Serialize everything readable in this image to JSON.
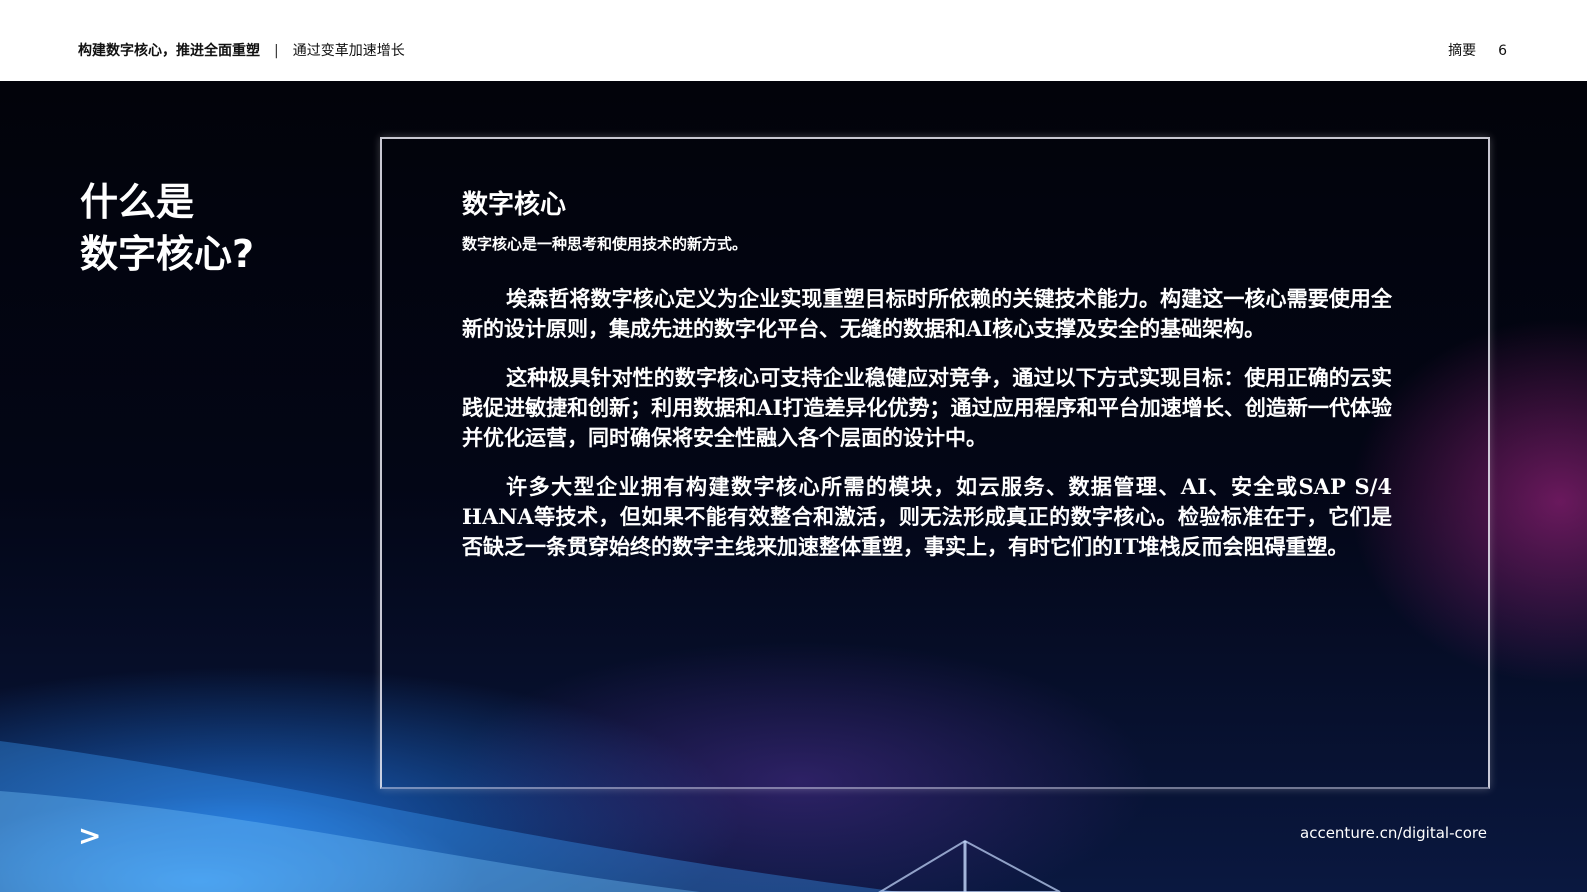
{
  "header": {
    "report_title": "构建数字核心，推进全面重塑",
    "separator": "|",
    "section": "通过变革加速增长",
    "chapter": "摘要",
    "page_number": "6"
  },
  "main": {
    "title_line1": "什么是",
    "title_line2": "数字核心?",
    "box": {
      "heading": "数字核心",
      "subheading": "数字核心是一种思考和使用技术的新方式。",
      "paragraphs": [
        "埃森哲将数字核心定义为企业实现重塑目标时所依赖的关键技术能力。构建这一核心需要使用全新的设计原则，集成先进的数字化平台、无缝的数据和AI核心支撑及安全的基础架构。",
        "这种极具针对性的数字核心可支持企业稳健应对竞争，通过以下方式实现目标：使用正确的云实践促进敏捷和创新；利用数据和AI打造差异化优势；通过应用程序和平台加速增长、创造新一代体验并优化运营，同时确保将安全性融入各个层面的设计中。",
        "许多大型企业拥有构建数字核心所需的模块，如云服务、数据管理、AI、安全或SAP S/4 HANA等技术，但如果不能有效整合和激活，则无法形成真正的数字核心。检验标准在于，它们是否缺乏一条贯穿始终的数字主线来加速整体重塑，事实上，有时它们的IT堆栈反而会阻碍重塑。"
      ]
    }
  },
  "footer": {
    "arrow": ">",
    "link": "accenture.cn/digital-core"
  }
}
